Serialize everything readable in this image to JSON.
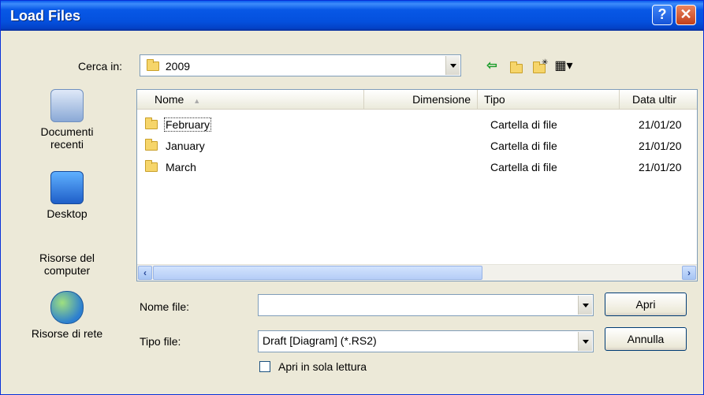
{
  "window": {
    "title": "Load Files"
  },
  "titlebar": {
    "help_glyph": "?",
    "close_glyph": "✕"
  },
  "lookin": {
    "label": "Cerca in:",
    "value": "2009"
  },
  "places": [
    {
      "label1": "Documenti",
      "label2": "recenti",
      "icon": "recent-documents-icon"
    },
    {
      "label1": "Desktop",
      "label2": "",
      "icon": "desktop-icon"
    },
    {
      "label1": "Risorse del",
      "label2": "computer",
      "icon": "my-computer-icon"
    },
    {
      "label1": "Risorse di rete",
      "label2": "",
      "icon": "network-icon"
    }
  ],
  "list": {
    "columns": [
      "Nome",
      "Dimensione",
      "Tipo",
      "Data ultir"
    ],
    "rows": [
      {
        "name": "February",
        "size": "",
        "type": "Cartella di file",
        "date": "21/01/20"
      },
      {
        "name": "January",
        "size": "",
        "type": "Cartella di file",
        "date": "21/01/20"
      },
      {
        "name": "March",
        "size": "",
        "type": "Cartella di file",
        "date": "21/01/20"
      }
    ]
  },
  "form": {
    "filename_label": "Nome file:",
    "filename_value": "",
    "filetype_label": "Tipo file:",
    "filetype_value": "Draft [Diagram]  (*.RS2)",
    "readonly_label": "Apri in sola lettura"
  },
  "buttons": {
    "open": "Apri",
    "cancel": "Annulla"
  },
  "colors": {
    "titlebar": "#0858e6",
    "dialog_bg": "#ece9d8",
    "close": "#c3401b"
  }
}
